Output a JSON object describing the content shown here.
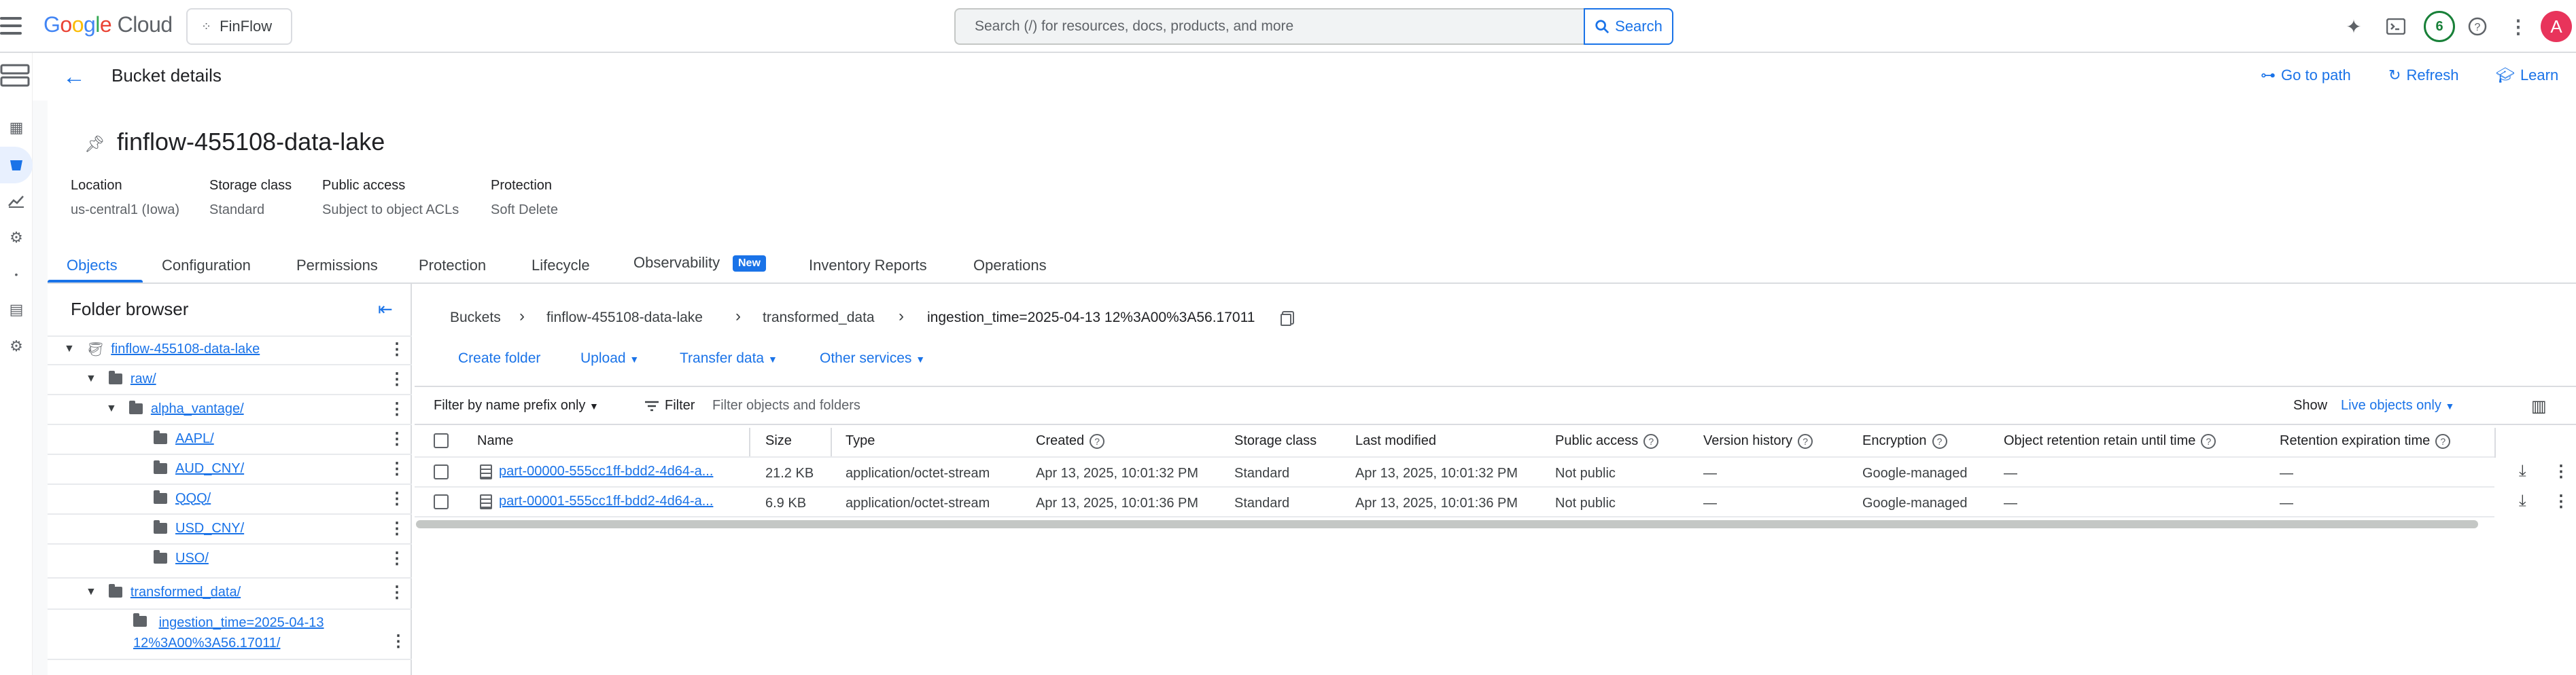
{
  "topbar": {
    "logo": "Google Cloud",
    "project": "FinFlow",
    "search_placeholder": "Search (/) for resources, docs, products, and more",
    "search_button": "Search",
    "notification_count": "6",
    "avatar_letter": "A"
  },
  "header": {
    "title": "Bucket details",
    "go_to_path": "Go to path",
    "refresh": "Refresh",
    "learn": "Learn"
  },
  "bucket": {
    "name": "finflow-455108-data-lake",
    "meta": [
      {
        "label": "Location",
        "value": "us-central1 (Iowa)"
      },
      {
        "label": "Storage class",
        "value": "Standard"
      },
      {
        "label": "Public access",
        "value": "Subject to object ACLs"
      },
      {
        "label": "Protection",
        "value": "Soft Delete"
      }
    ]
  },
  "tabs": [
    "Objects",
    "Configuration",
    "Permissions",
    "Protection",
    "Lifecycle",
    "Observability",
    "Inventory Reports",
    "Operations"
  ],
  "new_badge": "New",
  "folder_browser": {
    "title": "Folder browser",
    "items": [
      {
        "label": "finflow-455108-data-lake"
      },
      {
        "label": "raw/"
      },
      {
        "label": "alpha_vantage/"
      },
      {
        "label": "AAPL/"
      },
      {
        "label": "AUD_CNY/"
      },
      {
        "label": "QQQ/"
      },
      {
        "label": "USD_CNY/"
      },
      {
        "label": "USO/"
      },
      {
        "label": "transformed_data/"
      },
      {
        "label": "ingestion_time=2025-04-13",
        "label2": "12%3A00%3A56.17011/"
      }
    ]
  },
  "breadcrumbs": [
    "Buckets",
    "finflow-455108-data-lake",
    "transformed_data",
    "ingestion_time=2025-04-13 12%3A00%3A56.17011"
  ],
  "actions": {
    "create_folder": "Create folder",
    "upload": "Upload",
    "transfer": "Transfer data",
    "other": "Other services"
  },
  "filter": {
    "prefix": "Filter by name prefix only",
    "label": "Filter",
    "placeholder": "Filter objects and folders",
    "show": "Show",
    "show_value": "Live objects only"
  },
  "table": {
    "headers": [
      "Name",
      "Size",
      "Type",
      "Created",
      "Storage class",
      "Last modified",
      "Public access",
      "Version history",
      "Encryption",
      "Object retention retain until time",
      "Retention expiration time"
    ],
    "rows": [
      {
        "name": "part-00000-555cc1ff-bdd2-4d64-a...",
        "size": "21.2 KB",
        "type": "application/octet-stream",
        "created": "Apr 13, 2025, 10:01:32 PM",
        "storage": "Standard",
        "modified": "Apr 13, 2025, 10:01:32 PM",
        "public": "Not public",
        "version": "—",
        "encryption": "Google-managed",
        "retain": "—",
        "expire": "—"
      },
      {
        "name": "part-00001-555cc1ff-bdd2-4d64-a...",
        "size": "6.9 KB",
        "type": "application/octet-stream",
        "created": "Apr 13, 2025, 10:01:36 PM",
        "storage": "Standard",
        "modified": "Apr 13, 2025, 10:01:36 PM",
        "public": "Not public",
        "version": "—",
        "encryption": "Google-managed",
        "retain": "—",
        "expire": "—"
      }
    ]
  }
}
